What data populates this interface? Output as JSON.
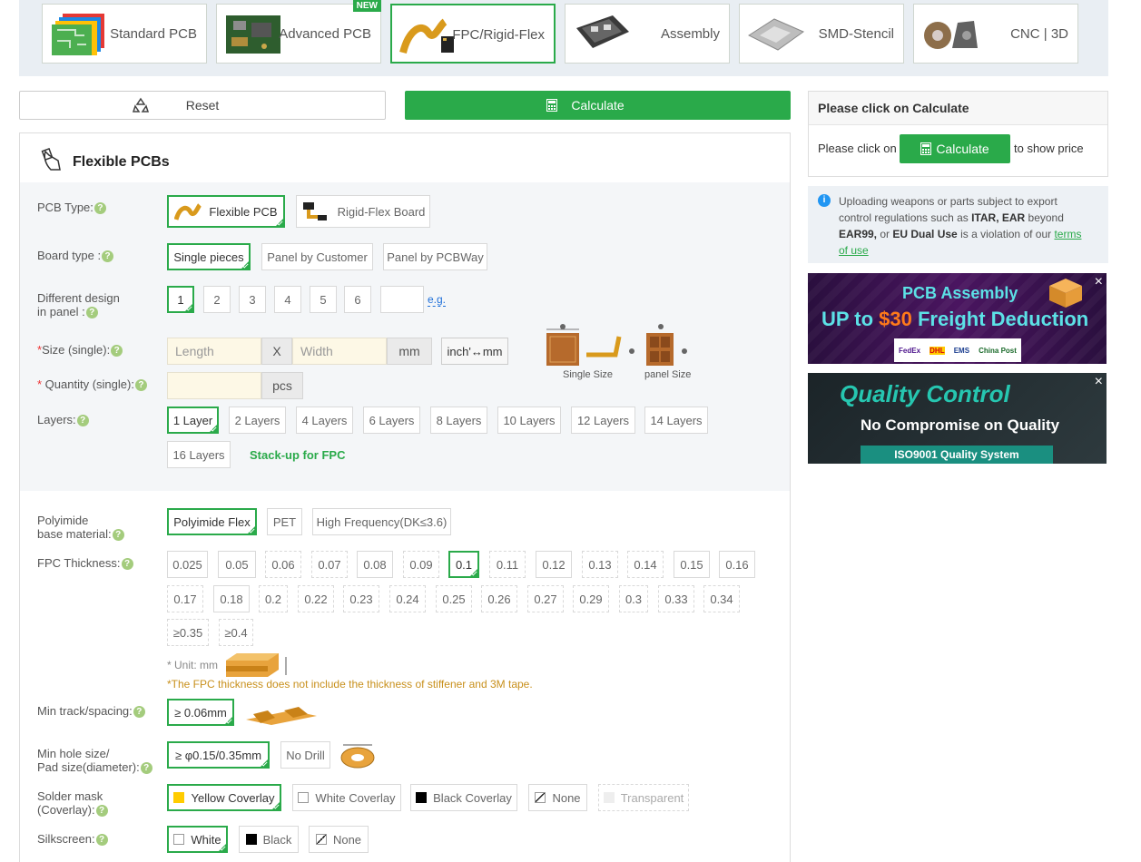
{
  "tabs": [
    {
      "label": "Standard PCB"
    },
    {
      "label": "Advanced PCB",
      "badge": "NEW"
    },
    {
      "label": "FPC/Rigid-Flex",
      "active": true
    },
    {
      "label": "Assembly"
    },
    {
      "label": "SMD-Stencil"
    },
    {
      "label": "CNC | 3D"
    }
  ],
  "actions": {
    "reset": "Reset",
    "calculate": "Calculate"
  },
  "section": {
    "title": "Flexible PCBs"
  },
  "pcb_type": {
    "label": "PCB Type:",
    "options": [
      "Flexible PCB",
      "Rigid-Flex Board"
    ],
    "selected": "Flexible PCB"
  },
  "board_type": {
    "label": "Board type :",
    "options": [
      "Single pieces",
      "Panel by Customer",
      "Panel by PCBWay"
    ],
    "selected": "Single pieces"
  },
  "diff_design": {
    "label_1": "Different design",
    "label_2": "in panel :",
    "options": [
      "1",
      "2",
      "3",
      "4",
      "5",
      "6"
    ],
    "selected": "1",
    "eg": "e.g."
  },
  "size": {
    "label": "Size (single):",
    "length_placeholder": "Length",
    "x": "X",
    "width_placeholder": "Width",
    "unit": "mm",
    "convert": "inch'↔mm",
    "single_caption": "Single Size",
    "panel_caption": "panel Size"
  },
  "quantity": {
    "label": "Quantity (single):",
    "unit": "pcs"
  },
  "layers": {
    "label": "Layers:",
    "options": [
      "1 Layer",
      "2 Layers",
      "4 Layers",
      "6 Layers",
      "8 Layers",
      "10 Layers",
      "12 Layers",
      "14 Layers",
      "16 Layers"
    ],
    "selected": "1 Layer",
    "stackup": "Stack-up for FPC"
  },
  "base_material": {
    "label_1": "Polyimide",
    "label_2": "base material:",
    "options": [
      "Polyimide Flex",
      "PET",
      "High Frequency(DK≤3.6)"
    ],
    "selected": "Polyimide Flex"
  },
  "thickness": {
    "label": "FPC Thickness:",
    "row1": [
      "0.025",
      "0.05",
      "0.06",
      "0.07",
      "0.08",
      "0.09",
      "0.1",
      "0.11",
      "0.12",
      "0.13",
      "0.14",
      "0.15",
      "0.16"
    ],
    "row2": [
      "0.17",
      "0.18",
      "0.2",
      "0.22",
      "0.23",
      "0.24",
      "0.25",
      "0.26",
      "0.27",
      "0.29",
      "0.3",
      "0.33",
      "0.34"
    ],
    "row3": [
      "≥0.35",
      "≥0.4"
    ],
    "selected": "0.1",
    "unit_note": "* Unit: mm",
    "note": "*The FPC thickness does not include the thickness of stiffener and 3M tape."
  },
  "min_track": {
    "label": "Min track/spacing:",
    "value": "≥ 0.06mm"
  },
  "min_hole": {
    "label_1": "Min hole size/",
    "label_2": "Pad size(diameter):",
    "options": [
      "≥ φ0.15/0.35mm",
      "No Drill"
    ],
    "selected": "≥ φ0.15/0.35mm"
  },
  "solder_mask": {
    "label_1": "Solder mask",
    "label_2": "(Coverlay):",
    "options": [
      "Yellow Coverlay",
      "White Coverlay",
      "Black Coverlay",
      "None",
      "Transparent"
    ],
    "selected": "Yellow Coverlay",
    "colors": {
      "yellow": "#ffcc00",
      "black": "#000000"
    }
  },
  "silkscreen": {
    "label": "Silkscreen:",
    "options": [
      "White",
      "Black",
      "None"
    ],
    "selected": "White"
  },
  "price_box": {
    "title": "Please click on Calculate",
    "pre": "Please click on",
    "button": "Calculate",
    "post": "to show price"
  },
  "warning": {
    "p1": "Uploading weapons or parts subject to export control regulations such as ",
    "b1": "ITAR, EAR",
    "p2": " beyond ",
    "b2": "EAR99,",
    "p3": " or ",
    "b3": "EU Dual Use",
    "p4": " is a violation of our ",
    "link": "terms of use"
  },
  "ad1": {
    "line1": "PCB Assembly",
    "line2a": "UP to ",
    "line2b": "$30",
    "line2c": " Freight Deduction",
    "carriers": [
      "FedEx",
      "DHL",
      "EMS",
      "China Post"
    ]
  },
  "ad2": {
    "line1": "Quality Control",
    "line2": "No Compromise on Quality",
    "line3": "ISO9001 Quality System"
  },
  "brand_colors": {
    "green": "#2aaa4a",
    "help": "#a4cc7d",
    "note": "#c8901c"
  }
}
